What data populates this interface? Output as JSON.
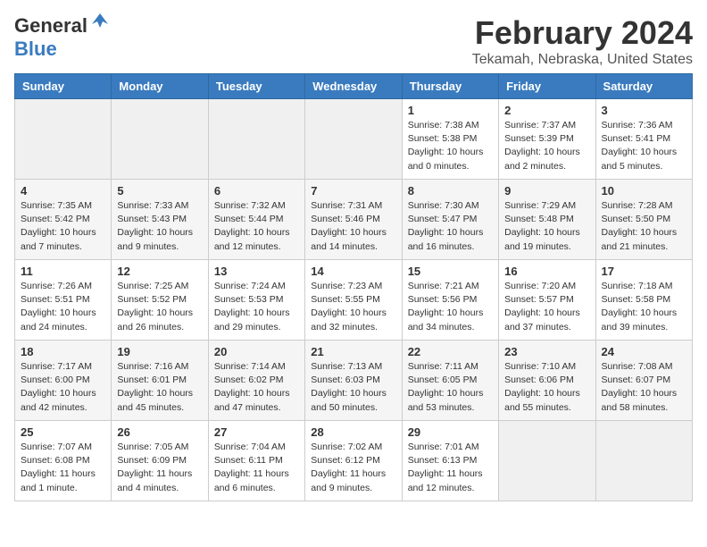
{
  "header": {
    "logo_general": "General",
    "logo_blue": "Blue",
    "month": "February 2024",
    "location": "Tekamah, Nebraska, United States"
  },
  "weekdays": [
    "Sunday",
    "Monday",
    "Tuesday",
    "Wednesday",
    "Thursday",
    "Friday",
    "Saturday"
  ],
  "weeks": [
    [
      {
        "day": "",
        "info": ""
      },
      {
        "day": "",
        "info": ""
      },
      {
        "day": "",
        "info": ""
      },
      {
        "day": "",
        "info": ""
      },
      {
        "day": "1",
        "info": "Sunrise: 7:38 AM\nSunset: 5:38 PM\nDaylight: 10 hours\nand 0 minutes."
      },
      {
        "day": "2",
        "info": "Sunrise: 7:37 AM\nSunset: 5:39 PM\nDaylight: 10 hours\nand 2 minutes."
      },
      {
        "day": "3",
        "info": "Sunrise: 7:36 AM\nSunset: 5:41 PM\nDaylight: 10 hours\nand 5 minutes."
      }
    ],
    [
      {
        "day": "4",
        "info": "Sunrise: 7:35 AM\nSunset: 5:42 PM\nDaylight: 10 hours\nand 7 minutes."
      },
      {
        "day": "5",
        "info": "Sunrise: 7:33 AM\nSunset: 5:43 PM\nDaylight: 10 hours\nand 9 minutes."
      },
      {
        "day": "6",
        "info": "Sunrise: 7:32 AM\nSunset: 5:44 PM\nDaylight: 10 hours\nand 12 minutes."
      },
      {
        "day": "7",
        "info": "Sunrise: 7:31 AM\nSunset: 5:46 PM\nDaylight: 10 hours\nand 14 minutes."
      },
      {
        "day": "8",
        "info": "Sunrise: 7:30 AM\nSunset: 5:47 PM\nDaylight: 10 hours\nand 16 minutes."
      },
      {
        "day": "9",
        "info": "Sunrise: 7:29 AM\nSunset: 5:48 PM\nDaylight: 10 hours\nand 19 minutes."
      },
      {
        "day": "10",
        "info": "Sunrise: 7:28 AM\nSunset: 5:50 PM\nDaylight: 10 hours\nand 21 minutes."
      }
    ],
    [
      {
        "day": "11",
        "info": "Sunrise: 7:26 AM\nSunset: 5:51 PM\nDaylight: 10 hours\nand 24 minutes."
      },
      {
        "day": "12",
        "info": "Sunrise: 7:25 AM\nSunset: 5:52 PM\nDaylight: 10 hours\nand 26 minutes."
      },
      {
        "day": "13",
        "info": "Sunrise: 7:24 AM\nSunset: 5:53 PM\nDaylight: 10 hours\nand 29 minutes."
      },
      {
        "day": "14",
        "info": "Sunrise: 7:23 AM\nSunset: 5:55 PM\nDaylight: 10 hours\nand 32 minutes."
      },
      {
        "day": "15",
        "info": "Sunrise: 7:21 AM\nSunset: 5:56 PM\nDaylight: 10 hours\nand 34 minutes."
      },
      {
        "day": "16",
        "info": "Sunrise: 7:20 AM\nSunset: 5:57 PM\nDaylight: 10 hours\nand 37 minutes."
      },
      {
        "day": "17",
        "info": "Sunrise: 7:18 AM\nSunset: 5:58 PM\nDaylight: 10 hours\nand 39 minutes."
      }
    ],
    [
      {
        "day": "18",
        "info": "Sunrise: 7:17 AM\nSunset: 6:00 PM\nDaylight: 10 hours\nand 42 minutes."
      },
      {
        "day": "19",
        "info": "Sunrise: 7:16 AM\nSunset: 6:01 PM\nDaylight: 10 hours\nand 45 minutes."
      },
      {
        "day": "20",
        "info": "Sunrise: 7:14 AM\nSunset: 6:02 PM\nDaylight: 10 hours\nand 47 minutes."
      },
      {
        "day": "21",
        "info": "Sunrise: 7:13 AM\nSunset: 6:03 PM\nDaylight: 10 hours\nand 50 minutes."
      },
      {
        "day": "22",
        "info": "Sunrise: 7:11 AM\nSunset: 6:05 PM\nDaylight: 10 hours\nand 53 minutes."
      },
      {
        "day": "23",
        "info": "Sunrise: 7:10 AM\nSunset: 6:06 PM\nDaylight: 10 hours\nand 55 minutes."
      },
      {
        "day": "24",
        "info": "Sunrise: 7:08 AM\nSunset: 6:07 PM\nDaylight: 10 hours\nand 58 minutes."
      }
    ],
    [
      {
        "day": "25",
        "info": "Sunrise: 7:07 AM\nSunset: 6:08 PM\nDaylight: 11 hours\nand 1 minute."
      },
      {
        "day": "26",
        "info": "Sunrise: 7:05 AM\nSunset: 6:09 PM\nDaylight: 11 hours\nand 4 minutes."
      },
      {
        "day": "27",
        "info": "Sunrise: 7:04 AM\nSunset: 6:11 PM\nDaylight: 11 hours\nand 6 minutes."
      },
      {
        "day": "28",
        "info": "Sunrise: 7:02 AM\nSunset: 6:12 PM\nDaylight: 11 hours\nand 9 minutes."
      },
      {
        "day": "29",
        "info": "Sunrise: 7:01 AM\nSunset: 6:13 PM\nDaylight: 11 hours\nand 12 minutes."
      },
      {
        "day": "",
        "info": ""
      },
      {
        "day": "",
        "info": ""
      }
    ]
  ]
}
